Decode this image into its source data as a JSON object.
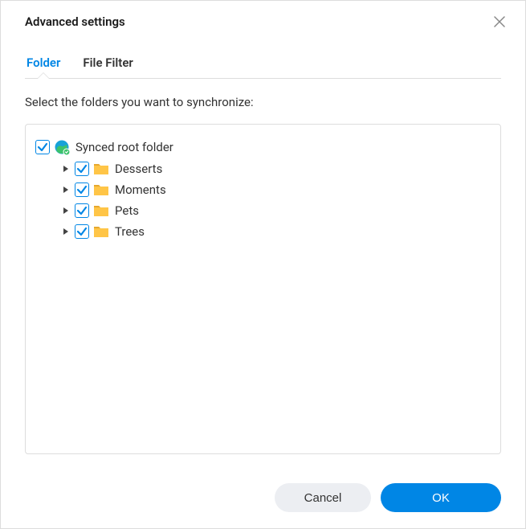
{
  "dialog": {
    "title": "Advanced settings"
  },
  "tabs": {
    "folder": "Folder",
    "file_filter": "File Filter"
  },
  "instruction": "Select the folders you want to synchronize:",
  "tree": {
    "root": {
      "label": "Synced root folder",
      "checked": true
    },
    "children": [
      {
        "label": "Desserts",
        "checked": true
      },
      {
        "label": "Moments",
        "checked": true
      },
      {
        "label": "Pets",
        "checked": true
      },
      {
        "label": "Trees",
        "checked": true
      }
    ]
  },
  "footer": {
    "cancel": "Cancel",
    "ok": "OK"
  },
  "colors": {
    "accent": "#0086E5",
    "folder": "#FFC547"
  }
}
